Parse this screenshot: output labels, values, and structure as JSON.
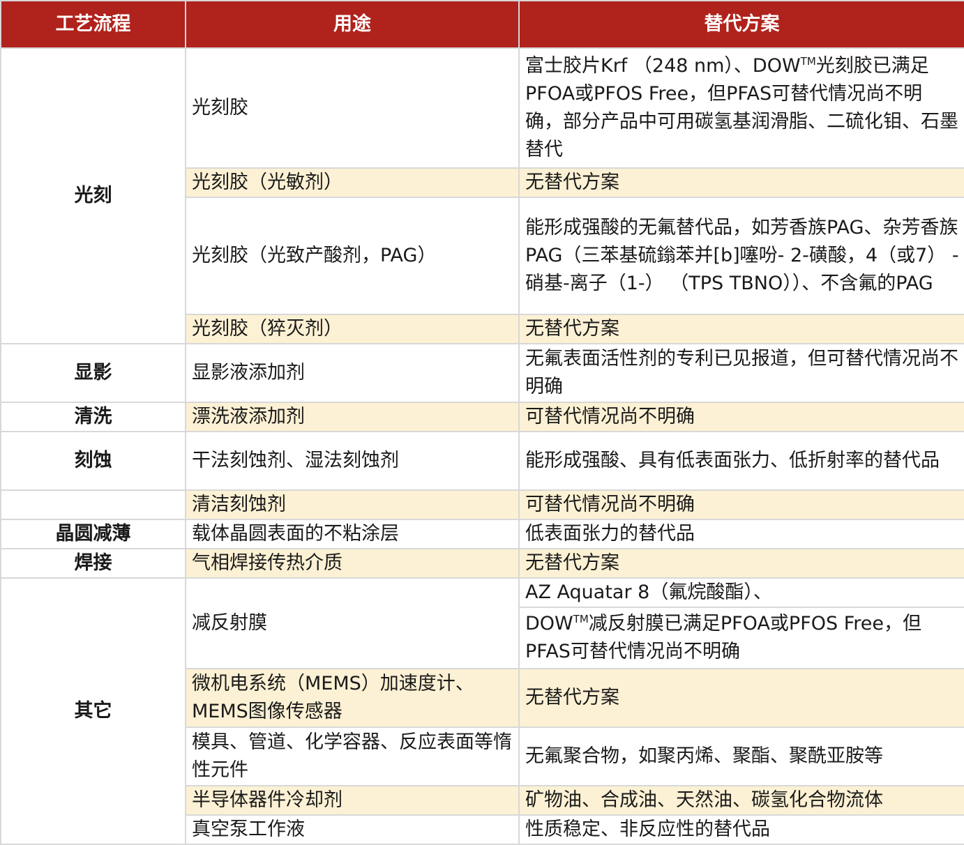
{
  "headers": [
    "工艺流程",
    "用途",
    "替代方案"
  ],
  "rows": {
    "r0": {
      "process": "光刻",
      "use": "光刻胶",
      "alt_a": "富士胶片Krf （248 nm）、DOW",
      "alt_tm": "TM",
      "alt_b": "光刻胶已满足PFOA或PFOS Free，但PFAS可替代情况尚不明确，部分产品中可用碳氢基润滑脂、二硫化钼、石墨替代"
    },
    "r1": {
      "use": "光刻胶（光敏剂）",
      "alt": "无替代方案"
    },
    "r2": {
      "use": "光刻胶（光致产酸剂，PAG）",
      "alt": "能形成强酸的无氟替代品，如芳香族PAG、杂芳香族PAG（三苯基硫鎓苯并[b]噻吩- 2-磺酸，4（或7） -硝基-离子（1-） （TPS TBNO））、不含氟的PAG"
    },
    "r3": {
      "use": "光刻胶（猝灭剂）",
      "alt": "无替代方案"
    },
    "r4": {
      "process": "显影",
      "use": "显影液添加剂",
      "alt": "无氟表面活性剂的专利已见报道，但可替代情况尚不明确"
    },
    "r5": {
      "process": "清洗",
      "use": "漂洗液添加剂",
      "alt": "可替代情况尚不明确"
    },
    "r6": {
      "process": "刻蚀",
      "use": "干法刻蚀剂、湿法刻蚀剂",
      "alt": "能形成强酸、具有低表面张力、低折射率的替代品"
    },
    "r7": {
      "use": "清洁刻蚀剂",
      "alt": "可替代情况尚不明确"
    },
    "r8": {
      "process": "晶圆减薄",
      "use": "载体晶圆表面的不粘涂层",
      "alt": "低表面张力的替代品"
    },
    "r9": {
      "process": "焊接",
      "use": "气相焊接传热介质",
      "alt": "无替代方案"
    },
    "r10": {
      "process": "其它",
      "use": "减反射膜",
      "alt": "AZ Aquatar 8（氟烷酸酯）、"
    },
    "r11": {
      "alt_a": "DOW",
      "alt_tm": "TM",
      "alt_b": "减反射膜已满足PFOA或PFOS Free，但PFAS可替代情况尚不明确"
    },
    "r12": {
      "use": "微机电系统（MEMS）加速度计、MEMS图像传感器",
      "alt": "无替代方案"
    },
    "r13": {
      "use": "模具、管道、化学容器、反应表面等惰性元件",
      "alt": "无氟聚合物，如聚丙烯、聚酯、聚酰亚胺等"
    },
    "r14": {
      "use": "半导体器件冷却剂",
      "alt": "矿物油、合成油、天然油、碳氢化合物流体"
    },
    "r15": {
      "use": "真空泵工作液",
      "alt": "性质稳定、非反应性的替代品"
    }
  }
}
